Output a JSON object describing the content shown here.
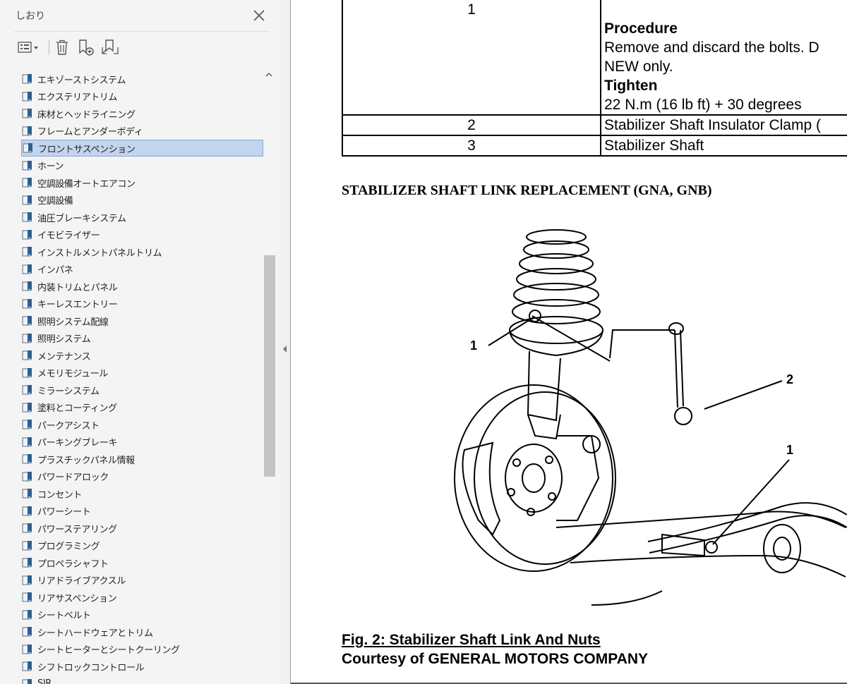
{
  "panel": {
    "title": "しおり",
    "toolbar": {
      "options_icon": "list-options-icon",
      "delete_icon": "trash-icon",
      "new_bookmark_icon": "new-bookmark-icon",
      "find_bookmark_icon": "find-current-bookmark-icon"
    },
    "bookmarks": [
      "エキゾーストシステム",
      "エクステリアトリム",
      "床材とヘッドライニング",
      "フレームとアンダーボディ",
      "フロントサスペンション",
      "ホーン",
      "空調設備オートエアコン",
      "空調設備",
      "油圧ブレーキシステム",
      "イモビライザー",
      "インストルメントパネルトリム",
      "インパネ",
      "内装トリムとパネル",
      "キーレスエントリー",
      "照明システム配線",
      "照明システム",
      "メンテナンス",
      "メモリモジュール",
      "ミラーシステム",
      "塗料とコーティング",
      "パークアシスト",
      "パーキングブレーキ",
      "プラスチックパネル情報",
      "パワードアロック",
      "コンセント",
      "パワーシート",
      "パワーステアリング",
      "プログラミング",
      "プロペラシャフト",
      "リアドライブアクスル",
      "リアサスペンション",
      "シートベルト",
      "シートハードウェアとトリム",
      "シートヒーターとシートクーリング",
      "シフトロックコントロール",
      "SIR"
    ],
    "selected_bookmark": "フロントサスペンション",
    "colors": {
      "selected_bg": "#c3d4ee",
      "bookmark_icon": "#2d5f8f"
    }
  },
  "document": {
    "table": [
      {
        "num": "1",
        "procedure_label": "Procedure",
        "procedure_text_1": "Remove and discard the bolts. D",
        "procedure_text_2": "NEW only.",
        "tighten_label": "Tighten",
        "tighten_text": "22 N.m (16 lb ft) + 30 degrees"
      },
      {
        "num": "2",
        "desc": "Stabilizer Shaft Insulator Clamp ("
      },
      {
        "num": "3",
        "desc": "Stabilizer Shaft"
      }
    ],
    "section_heading": "STABILIZER SHAFT LINK REPLACEMENT (GNA, GNB)",
    "figure": {
      "callout_1a": "1",
      "callout_1b": "1",
      "callout_2": "2"
    },
    "caption": "Fig. 2: Stabilizer Shaft Link And Nuts",
    "courtesy": "Courtesy of GENERAL MOTORS COMPANY"
  }
}
